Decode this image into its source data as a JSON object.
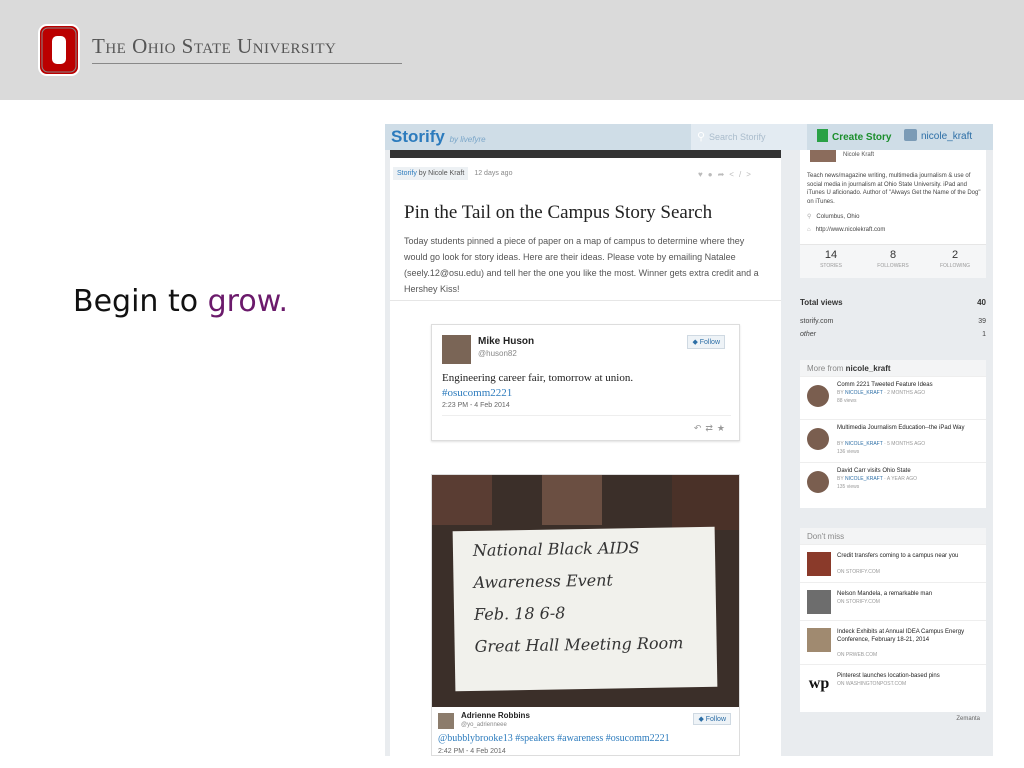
{
  "slide": {
    "university_name": "The Ohio State University",
    "headline_prefix": "Begin to ",
    "headline_accent": "grow.",
    "logo_letter": "O",
    "brand_color": "#bb0000",
    "accent_color": "#6b1a6b"
  },
  "topbar": {
    "brand": "Storify",
    "brand_sub": "by livefyre",
    "search_placeholder": "Search Storify",
    "create_label": "Create Story",
    "username": "nicole_kraft"
  },
  "story": {
    "source_brand": "Storify",
    "source_by": "by Nicole Kraft",
    "time_ago": "12 days ago",
    "title": "Pin the Tail on the Campus Story Search",
    "description": "Today students pinned a piece of paper on a map of campus to determine where they would go look for story ideas. Here are their ideas. Please vote by emailing Natalee (seely.12@osu.edu) and tell her the one you like the most. Winner gets extra credit and a Hershey Kiss!"
  },
  "tweet1": {
    "name": "Mike Huson",
    "handle": "@huson82",
    "follow": "Follow",
    "text": "Engineering career fair, tomorrow at union.",
    "hashtag": "#osucomm2221",
    "date": "2:23 PM - 4 Feb 2014"
  },
  "tweet2": {
    "card_lines": [
      "National Black AIDS",
      "Awareness Event",
      "Feb. 18  6-8",
      "Great Hall Meeting Room"
    ],
    "name": "Adrienne Robbins",
    "handle": "@yo_adrienneee",
    "follow": "Follow",
    "text": "@bubblybrooke13 #speakers #awareness #osucomm2221",
    "date": "2:42 PM - 4 Feb 2014"
  },
  "profile": {
    "display_name": "Nicole Kraft",
    "bio": "Teach news/magazine writing, multimedia journalism & use of social media in journalism at Ohio State University. iPad and iTunes U aficionado. Author of \"Always Get the Name of the Dog\" on iTunes.",
    "location": "Columbus, Ohio",
    "url": "http://www.nicolekraft.com",
    "stats": [
      {
        "value": "14",
        "label": "STORIES"
      },
      {
        "value": "8",
        "label": "FOLLOWERS"
      },
      {
        "value": "2",
        "label": "FOLLOWING"
      }
    ]
  },
  "views": {
    "heading": "Total views",
    "total": "40",
    "rows": [
      {
        "label": "storify.com",
        "value": "39"
      },
      {
        "label": "other",
        "value": "1"
      }
    ]
  },
  "more_from": {
    "heading_prefix": "More from ",
    "heading_user": "nicole_kraft",
    "items": [
      {
        "title": "Comm 2221 Tweeted Feature Ideas",
        "by": "BY",
        "author": "NICOLE_KRAFT",
        "when": "· 2 MONTHS AGO",
        "views": "88 views"
      },
      {
        "title": "Multimedia Journalism Education--the iPad Way",
        "by": "BY",
        "author": "NICOLE_KRAFT",
        "when": "· 5 MONTHS AGO",
        "views": "136 views"
      },
      {
        "title": "David Carr visits Ohio State",
        "by": "BY",
        "author": "NICOLE_KRAFT",
        "when": "· A YEAR AGO",
        "views": "135 views"
      }
    ]
  },
  "dont_miss": {
    "heading": "Don't miss",
    "items": [
      {
        "title": "Credit transfers coming to a campus near you",
        "source": "ON STORIFY.COM"
      },
      {
        "title": "Nelson Mandela, a remarkable man",
        "source": "ON STORIFY.COM"
      },
      {
        "title": "Indeck Exhibits at Annual IDEA Campus Energy Conference, February 18-21, 2014",
        "source": "ON PRWEB.COM"
      },
      {
        "title": "Pinterest launches location-based pins",
        "source": "ON WASHINGTONPOST.COM",
        "logo": "wp"
      }
    ],
    "footer": "Zemanta"
  }
}
